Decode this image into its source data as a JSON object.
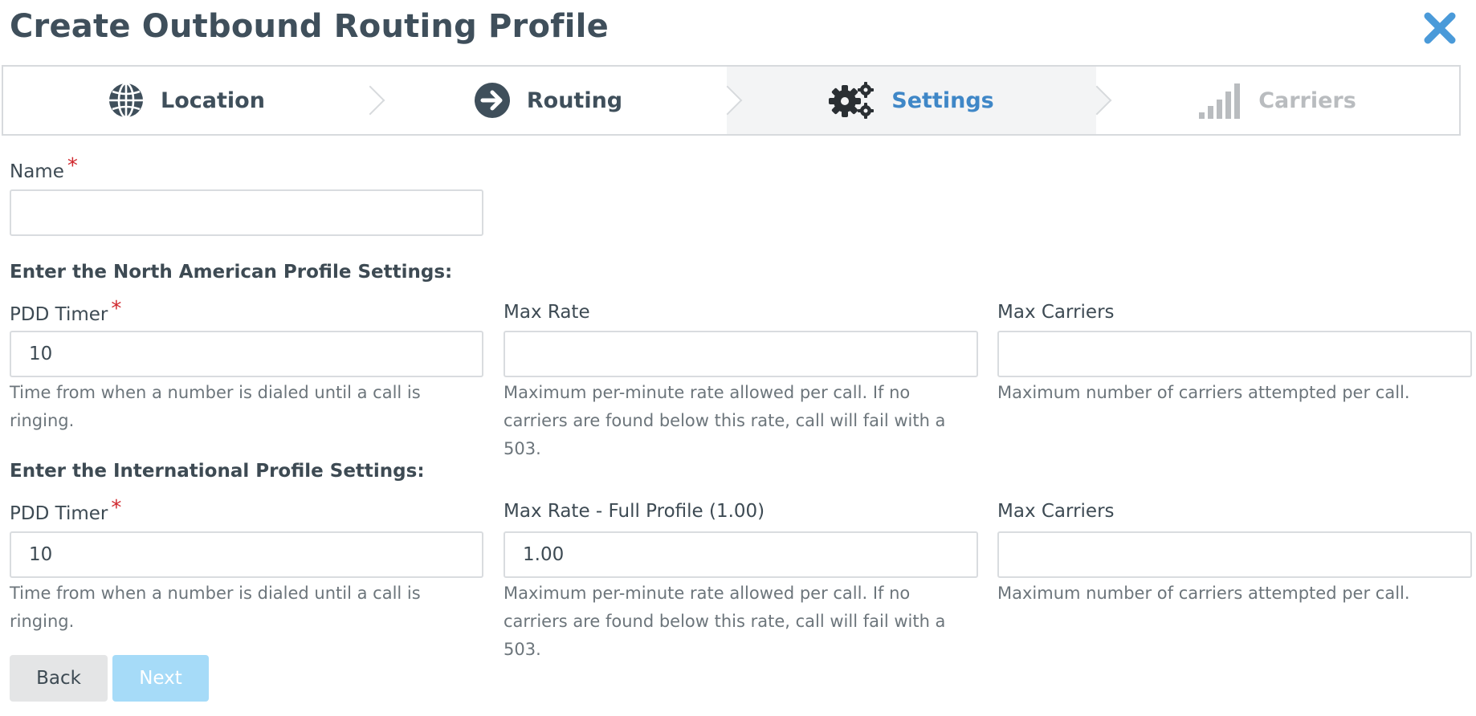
{
  "header": {
    "title": "Create Outbound Routing Profile",
    "close_icon": "close-icon"
  },
  "steps": [
    {
      "label": "Location",
      "icon": "globe-icon",
      "state": "completed"
    },
    {
      "label": "Routing",
      "icon": "arrow-right-circle-icon",
      "state": "completed"
    },
    {
      "label": "Settings",
      "icon": "gears-icon",
      "state": "active"
    },
    {
      "label": "Carriers",
      "icon": "signal-bars-icon",
      "state": "disabled"
    }
  ],
  "form": {
    "name": {
      "label": "Name",
      "required": "*",
      "value": ""
    },
    "north_american": {
      "heading": "Enter the North American Profile Settings:",
      "pdd_timer": {
        "label": "PDD Timer",
        "required": "*",
        "value": "10",
        "help": "Time from when a number is dialed until a call is ringing."
      },
      "max_rate": {
        "label": "Max Rate",
        "value": "",
        "help": "Maximum per-minute rate allowed per call. If no carriers are found below this rate, call will fail with a 503."
      },
      "max_carriers": {
        "label": "Max Carriers",
        "value": "",
        "help": "Maximum number of carriers attempted per call."
      }
    },
    "international": {
      "heading": "Enter the International Profile Settings:",
      "pdd_timer": {
        "label": "PDD Timer",
        "required": "*",
        "value": "10",
        "help": "Time from when a number is dialed until a call is ringing."
      },
      "max_rate": {
        "label": "Max Rate - Full Profile (1.00)",
        "value": "1.00",
        "help": "Maximum per-minute rate allowed per call. If no carriers are found below this rate, call will fail with a 503."
      },
      "max_carriers": {
        "label": "Max Carriers",
        "value": "",
        "help": "Maximum number of carriers attempted per call."
      }
    }
  },
  "buttons": {
    "back": "Back",
    "next": "Next"
  },
  "colors": {
    "accent": "#3f87c7",
    "required": "#d0282e",
    "next_button": "#a6dbf8",
    "close": "#4a9ad9"
  }
}
